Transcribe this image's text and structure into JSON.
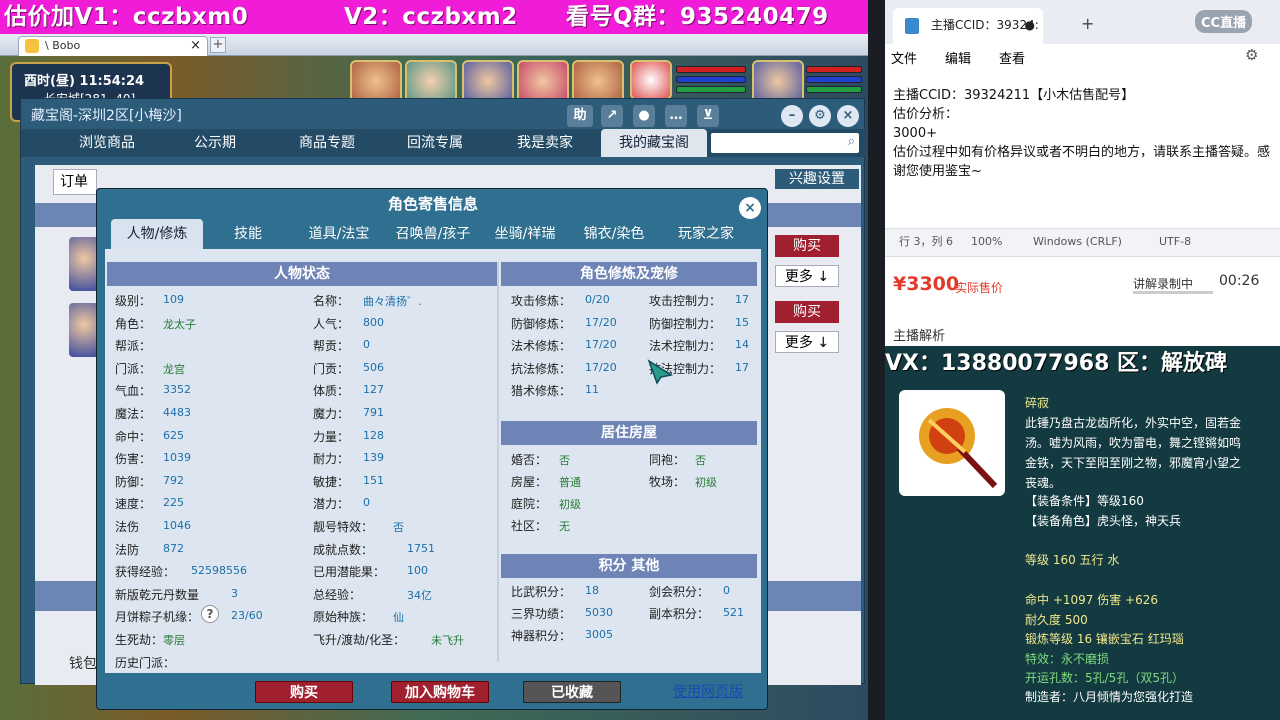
{
  "banner": {
    "v1": "估价加V1：cczbxm0",
    "v2": "V2：cczbxm2",
    "qq": "看号Q群：935240479"
  },
  "browser": {
    "tab_title": "\\ Bobo",
    "close": "×",
    "new_tab": "+"
  },
  "game": {
    "clock": "酉时(昼) 11:54:24",
    "location": "长安城[281, 40]"
  },
  "shop": {
    "title": "藏宝阁-深圳2区[小梅沙]",
    "tabs": [
      "浏览商品",
      "公示期",
      "商品专题",
      "回流专属",
      "我是卖家",
      "我的藏宝阁"
    ],
    "help": "助",
    "order_label": "订单",
    "interest_label": "兴趣设置",
    "buy_label": "购买",
    "more_label": "更多",
    "wallet_label": "钱包余"
  },
  "dialog": {
    "title": "角色寄售信息",
    "tabs": [
      "人物/修炼",
      "技能",
      "道具/法宝",
      "召唤兽/孩子",
      "坐骑/祥瑞",
      "锦衣/染色",
      "玩家之家"
    ],
    "sections": {
      "status": "人物状态",
      "cultivation": "角色修炼及宠修",
      "house": "居住房屋",
      "points": "积分 其他"
    },
    "left_col": [
      [
        "级别：",
        "109"
      ],
      [
        "角色：",
        "龙太子"
      ],
      [
        "帮派：",
        ""
      ],
      [
        "门派：",
        "龙宫"
      ],
      [
        "气血：",
        "3352"
      ],
      [
        "魔法：",
        "4483"
      ],
      [
        "命中：",
        "625"
      ],
      [
        "伤害：",
        "1039"
      ],
      [
        "防御：",
        "792"
      ],
      [
        "速度：",
        "225"
      ],
      [
        "法伤",
        "1046"
      ],
      [
        "法防",
        "872"
      ],
      [
        "获得经验：",
        "52598556"
      ],
      [
        "新版乾元丹数量",
        "3"
      ],
      [
        "月饼粽子机缘：",
        "23/60"
      ],
      [
        "生死劫：",
        "零层"
      ],
      [
        "历史门派：",
        ""
      ]
    ],
    "mid_col": [
      [
        "名称：",
        "曲々清扬゛."
      ],
      [
        "人气：",
        "800"
      ],
      [
        "帮贡：",
        "0"
      ],
      [
        "门贡：",
        "506"
      ],
      [
        "体质：",
        "127"
      ],
      [
        "魔力：",
        "791"
      ],
      [
        "力量：",
        "128"
      ],
      [
        "耐力：",
        "139"
      ],
      [
        "敏捷：",
        "151"
      ],
      [
        "潜力：",
        "0"
      ],
      [
        "靓号特效：",
        "否"
      ],
      [
        "成就点数：",
        "1751"
      ],
      [
        "已用潜能果：",
        "100"
      ],
      [
        "总经验：",
        "34亿"
      ],
      [
        "原始种族：",
        "仙"
      ],
      [
        "飞升/渡劫/化圣：",
        "未飞升"
      ]
    ],
    "cult_rows": [
      [
        "攻击修炼：",
        "0/20",
        "攻击控制力：",
        "17"
      ],
      [
        "防御修炼：",
        "17/20",
        "防御控制力：",
        "15"
      ],
      [
        "法术修炼：",
        "17/20",
        "法术控制力：",
        "14"
      ],
      [
        "抗法修炼：",
        "17/20",
        "抗法控制力：",
        "17"
      ],
      [
        "猎术修炼：",
        "11",
        "",
        ""
      ]
    ],
    "house_rows": [
      [
        "婚否：",
        "否",
        "同袍：",
        "否"
      ],
      [
        "房屋：",
        "普通",
        "牧场：",
        "初级"
      ],
      [
        "庭院：",
        "初级",
        "",
        ""
      ],
      [
        "社区：",
        "无",
        "",
        ""
      ]
    ],
    "point_rows": [
      [
        "比武积分：",
        "18",
        "剑会积分：",
        "0"
      ],
      [
        "三界功绩：",
        "5030",
        "副本积分：",
        "521"
      ],
      [
        "神器积分：",
        "3005",
        "",
        ""
      ]
    ],
    "buttons": {
      "buy": "购买",
      "add_cart": "加入购物车",
      "favorited": "已收藏",
      "web_version": "使用网页版"
    },
    "close": "×",
    "help_mark": "?"
  },
  "notepad": {
    "tab_title": "主播CCID：39324:",
    "menu": [
      "文件",
      "编辑",
      "查看"
    ],
    "lines": [
      "主播CCID：39324211【小木估售配号】",
      "估价分析：",
      "3000+",
      "估价过程中如有价格异议或者不明白的地方，请联系主播答疑。感谢您使用鉴宝~"
    ],
    "status": [
      "行 3，列 6",
      "100%",
      "Windows (CRLF)",
      "UTF-8"
    ],
    "watermark": "CC直播"
  },
  "price": {
    "amount": "¥3300",
    "label": "实际售价",
    "recording": "讲解录制中",
    "time": "00:26",
    "analysis": "主播解析"
  },
  "item": {
    "vx_banner": "VX：13880077968 区：解放碑",
    "name": "碎寂",
    "desc": [
      "此锤乃盘古龙齿所化，外实中空，固若金",
      "汤。嘘为风雨，吹为雷电，舞之铿锵如鸣",
      "金铁，天下至阳至刚之物，邪魔宵小望之",
      "丧魂。"
    ],
    "cond": "【装备条件】等级160",
    "role": "【装备角色】虎头怪，神天兵",
    "level": "等级 160 五行 水",
    "hit": "命中 +1097 伤害 +626",
    "durability": "耐久度 500",
    "forge": "锻炼等级 16 镶嵌宝石 红玛瑙",
    "effect": "特效：永不磨损",
    "holes": "开运孔数：5孔/5孔（双5孔）",
    "maker": "制造者：八月倾情为您强化打造"
  },
  "colors": {
    "banner": "#f01cd8",
    "dialog_bg": "#2f6f8f",
    "section": "#6e84b6",
    "buy_red": "#a02030",
    "price_red": "#e23a2a"
  }
}
